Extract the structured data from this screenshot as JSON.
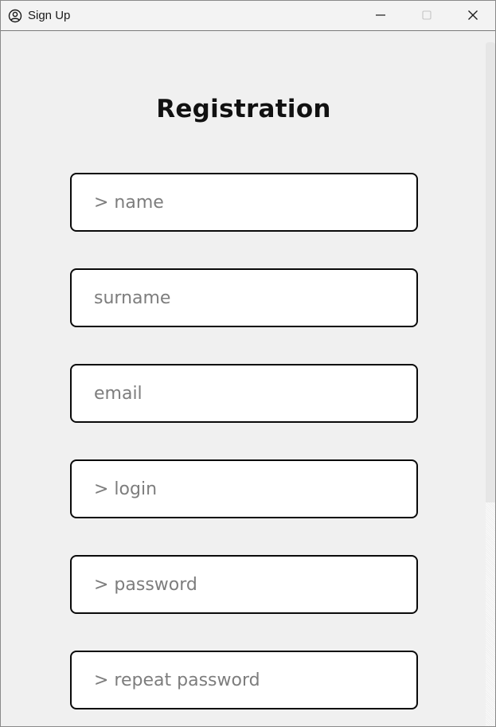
{
  "window": {
    "title": "Sign Up",
    "controls": {
      "minimize": "minimize",
      "maximize": "maximize",
      "close": "close"
    }
  },
  "form": {
    "heading": "Registration",
    "fields": [
      {
        "placeholder": "> name"
      },
      {
        "placeholder": "surname"
      },
      {
        "placeholder": "email"
      },
      {
        "placeholder": "> login"
      },
      {
        "placeholder": "> password"
      },
      {
        "placeholder": "> repeat password"
      }
    ]
  },
  "colors": {
    "background": "#f0f0f0",
    "field_border": "#0a0a0a",
    "placeholder": "#7d7d7d",
    "heading": "#111111"
  },
  "icons": {
    "app": "user-circle-icon",
    "minimize": "minimize-icon",
    "maximize": "maximize-icon",
    "close": "close-icon"
  }
}
